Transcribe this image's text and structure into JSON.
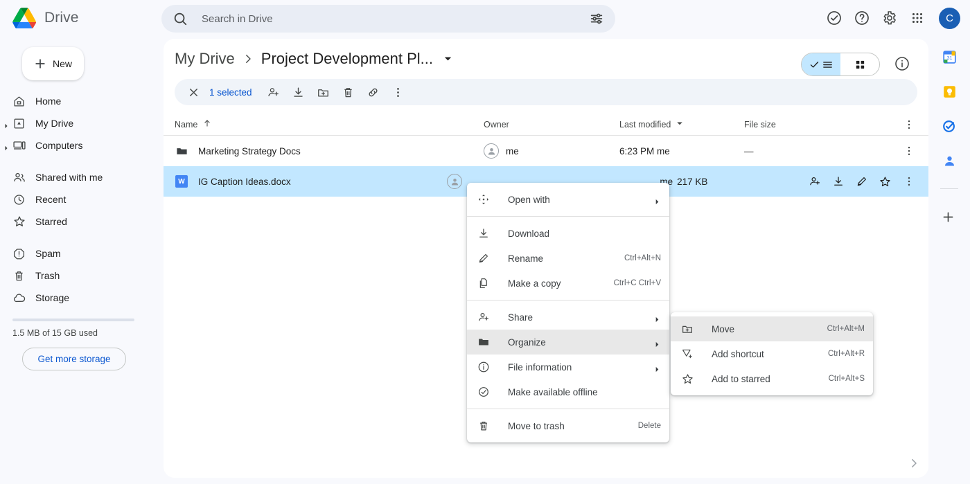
{
  "app": {
    "name": "Drive",
    "logo": "drive-logo",
    "avatar_letter": "C",
    "avatar_color": "#1a5fb4"
  },
  "search": {
    "placeholder": "Search in Drive",
    "value": "",
    "icon": "search-icon",
    "filter_icon": "tune-icon"
  },
  "top_actions": [
    {
      "name": "activity-icon",
      "label": "Activity"
    },
    {
      "name": "help-icon",
      "label": "Support"
    },
    {
      "name": "gear-icon",
      "label": "Settings"
    },
    {
      "name": "apps-grid-icon",
      "label": "Google apps"
    }
  ],
  "sidebar": {
    "new_button": "New",
    "items": [
      {
        "label": "Home",
        "icon": "home-icon",
        "expandable": false
      },
      {
        "label": "My Drive",
        "icon": "my-drive-icon",
        "expandable": true
      },
      {
        "label": "Computers",
        "icon": "computers-icon",
        "expandable": true
      },
      {
        "label": "Shared with me",
        "icon": "shared-people-icon",
        "expandable": false
      },
      {
        "label": "Recent",
        "icon": "clock-icon",
        "expandable": false
      },
      {
        "label": "Starred",
        "icon": "star-icon",
        "expandable": false
      },
      {
        "label": "Spam",
        "icon": "spam-icon",
        "expandable": false
      },
      {
        "label": "Trash",
        "icon": "trash-icon",
        "expandable": false
      },
      {
        "label": "Storage",
        "icon": "cloud-icon",
        "expandable": false
      }
    ],
    "storage_text": "1.5 MB of 15 GB used",
    "storage_button": "Get more storage"
  },
  "breadcrumb": {
    "root": "My Drive",
    "separator": "›",
    "current": "Project Development Pl...",
    "caret_icon": "chevron-down-icon"
  },
  "view_toggle": {
    "list_label": "List view",
    "grid_label": "Grid view",
    "active": "list",
    "info_icon": "info-icon"
  },
  "selection_toolbar": {
    "close_icon": "close-icon",
    "count_text": "1 selected",
    "actions": [
      {
        "name": "share-person-add-icon",
        "label": "Share"
      },
      {
        "name": "download-icon",
        "label": "Download"
      },
      {
        "name": "move-to-folder-icon",
        "label": "Move"
      },
      {
        "name": "trash-icon",
        "label": "Move to trash"
      },
      {
        "name": "link-icon",
        "label": "Get link"
      },
      {
        "name": "more-vert-icon",
        "label": "More actions"
      }
    ]
  },
  "table": {
    "columns": [
      {
        "key": "name",
        "label": "Name",
        "sort": "asc",
        "sort_icon": "arrow-up-icon"
      },
      {
        "key": "owner",
        "label": "Owner"
      },
      {
        "key": "modified",
        "label": "Last modified",
        "sort_icon": "chevron-down-icon"
      },
      {
        "key": "size",
        "label": "File size"
      }
    ],
    "header_kebab": "more-vert-icon",
    "rows": [
      {
        "icon": "folder-icon",
        "name": "Marketing Strategy Docs",
        "owner": "me",
        "modified": "6:23 PM  me",
        "size": "—",
        "selected": false
      },
      {
        "icon": "docx-icon",
        "icon_letter": "W",
        "name": "IG Caption Ideas.docx",
        "owner": "me",
        "modified": "me",
        "size": "217 KB",
        "selected": true,
        "hover_actions": [
          {
            "name": "share-person-add-icon",
            "label": "Share"
          },
          {
            "name": "download-icon",
            "label": "Download"
          },
          {
            "name": "rename-pencil-icon",
            "label": "Rename"
          },
          {
            "name": "star-icon",
            "label": "Add to starred"
          },
          {
            "name": "more-vert-icon",
            "label": "More actions"
          }
        ]
      }
    ],
    "scroll_chevron": "chevron-right-icon"
  },
  "context_menu": {
    "items": [
      {
        "label": "Open with",
        "icon": "open-with-icon",
        "shortcut": "",
        "submenu": true,
        "divider_after": true
      },
      {
        "label": "Download",
        "icon": "download-icon",
        "shortcut": "",
        "submenu": false
      },
      {
        "label": "Rename",
        "icon": "rename-pencil-icon",
        "shortcut": "Ctrl+Alt+N",
        "submenu": false
      },
      {
        "label": "Make a copy",
        "icon": "copy-icon",
        "shortcut": "Ctrl+C Ctrl+V",
        "submenu": false,
        "divider_after": true
      },
      {
        "label": "Share",
        "icon": "share-person-add-icon",
        "shortcut": "",
        "submenu": true
      },
      {
        "label": "Organize",
        "icon": "folder-icon",
        "shortcut": "",
        "submenu": true,
        "highlighted": true
      },
      {
        "label": "File information",
        "icon": "info-icon",
        "shortcut": "",
        "submenu": true
      },
      {
        "label": "Make available offline",
        "icon": "offline-check-icon",
        "shortcut": "",
        "submenu": false,
        "divider_after": true
      },
      {
        "label": "Move to trash",
        "icon": "trash-icon",
        "shortcut": "Delete",
        "submenu": false
      }
    ]
  },
  "submenu": {
    "items": [
      {
        "label": "Move",
        "icon": "move-to-folder-icon",
        "shortcut": "Ctrl+Alt+M",
        "highlighted": true
      },
      {
        "label": "Add shortcut",
        "icon": "add-shortcut-icon",
        "shortcut": "Ctrl+Alt+R",
        "highlighted": false
      },
      {
        "label": "Add to starred",
        "icon": "star-icon",
        "shortcut": "Ctrl+Alt+S",
        "highlighted": false
      }
    ]
  },
  "right_rail": {
    "items": [
      {
        "name": "google-calendar-icon",
        "label": "Calendar"
      },
      {
        "name": "google-keep-icon",
        "label": "Keep"
      },
      {
        "name": "google-tasks-icon",
        "label": "Tasks"
      },
      {
        "name": "google-contacts-icon",
        "label": "Contacts"
      }
    ],
    "add_label": "Get add-ons",
    "add_icon": "plus-icon"
  }
}
